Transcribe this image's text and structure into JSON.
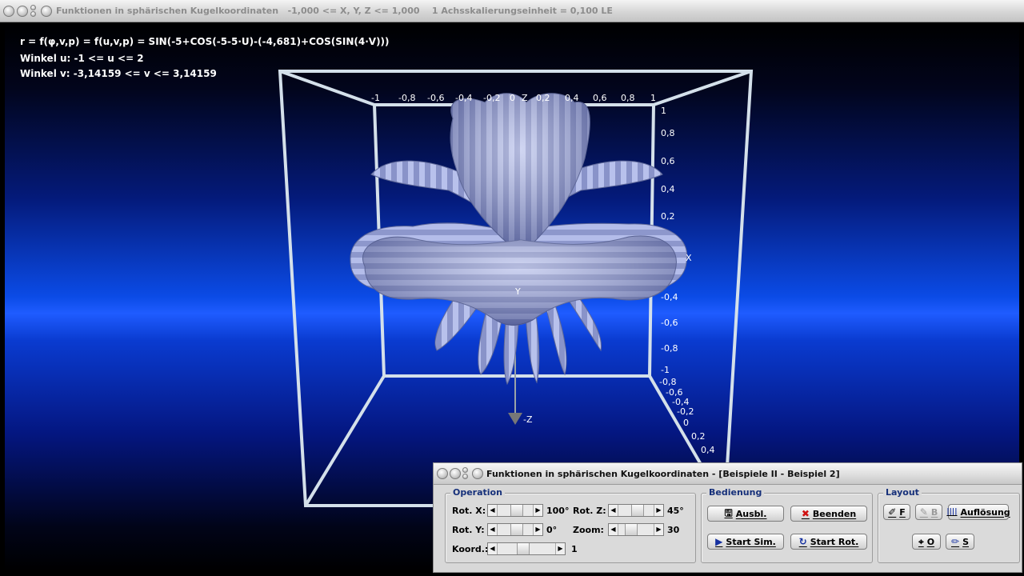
{
  "main_window": {
    "title": "Funktionen in sphärischen Kugelkoordinaten   -1,000 <= X, Y, Z <= 1,000    1 Achsskalierungseinheit = 0,100 LE"
  },
  "overlay": {
    "formula": "r = f(φ,v,p) = f(u,v,p) = SIN(-5+COS(-5-5·U)-(-4,681)+COS(SIN(4·V)))",
    "angle_u": "Winkel u: -1 <= u <= 2",
    "angle_v": "Winkel v: -3,14159 <= v <= 3,14159"
  },
  "axes": {
    "top_ticks": [
      "-1",
      "-0,8",
      "-0,6",
      "-0,4",
      "-0,2",
      "0",
      "Z",
      "0,2",
      "0,4",
      "0,6",
      "0,8",
      "1"
    ],
    "right_ticks": [
      "1",
      "0,8",
      "0,6",
      "0,4",
      "0,2",
      "X",
      "-0,4",
      "-0,6",
      "-0,8",
      "-1"
    ],
    "depth_ticks": [
      "-0,8",
      "-0,6",
      "-0,4",
      "-0,2",
      "0",
      "0,2",
      "0,4"
    ],
    "neg_z_label": "-Z",
    "y_label": "Y"
  },
  "control_window": {
    "title": "Funktionen in sphärischen Kugelkoordinaten - [Beispiele II - Beispiel 2]",
    "operation": {
      "legend": "Operation",
      "rot_x_label": "Rot. X:",
      "rot_x_value": "100°",
      "rot_y_label": "Rot. Y:",
      "rot_y_value": "0°",
      "koord_label": "Koord.:",
      "koord_value": "1",
      "rot_z_label": "Rot. Z:",
      "rot_z_value": "45°",
      "zoom_label": "Zoom:",
      "zoom_value": "30"
    },
    "bedienung": {
      "legend": "Bedienung",
      "ausbl": "Ausbl.",
      "beenden": "Beenden",
      "start_sim": "Start Sim.",
      "start_rot": "Start Rot."
    },
    "layout": {
      "legend": "Layout",
      "f": "F",
      "b": "B",
      "aufloesung": "Auflösung",
      "o": "O",
      "s": "S"
    }
  },
  "colors": {
    "background_glow": "#1f5cff",
    "surface": "#a9b3e6",
    "frame": "#d7e3ee",
    "legend_text": "#16307a"
  }
}
